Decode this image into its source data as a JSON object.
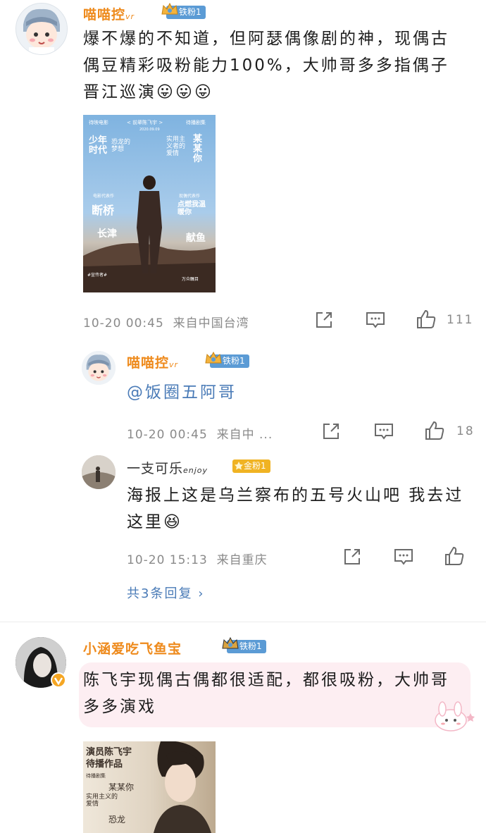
{
  "comments": [
    {
      "username": "喵喵控",
      "username_suffix": "vr",
      "badge": "铁粉1",
      "text": "爆不爆的不知道，但阿瑟偶像剧的神，现偶古偶豆精彩吸粉能力100%，大帅哥多多指偶子晋江巡演",
      "emoji": "😛😛😛",
      "timestamp": "10-20 00:45",
      "source": "来自中国台湾",
      "like_count": "111"
    },
    {
      "username": "喵喵控",
      "username_suffix": "vr",
      "badge": "铁粉1",
      "mention": "@饭圈五阿哥",
      "timestamp": "10-20 00:45",
      "source": "来自中 ...",
      "like_count": "18"
    },
    {
      "username": "一支可乐",
      "username_suffix": "enjoy",
      "badge": "金粉1",
      "text": "海报上这是乌兰察布的五号火山吧 我去过这里",
      "emoji": "😆",
      "timestamp": "10-20 15:13",
      "source": "来自重庆",
      "like_count": ""
    },
    {
      "username": "小涵爱吃飞鱼宝",
      "badge": "铁粉1",
      "text": "陈飞宇现偶古偶都很适配，都很吸粉，大帅哥多多演戏"
    }
  ],
  "replies_link": "共3条回复",
  "poster1": {
    "header_left": "待映电影",
    "header_mid": "< 前辈陈飞宇 >",
    "header_right": "待播剧集",
    "date": "2020.09.09",
    "title_left": "少年时代",
    "title_left2": "恐龙的梦想",
    "title_right": "实用主义者的爱情",
    "title_right2": "某某你",
    "film_rep_label": "电影代表作",
    "film_rep": "断桥",
    "film_rep2": "长津",
    "tv_rep_label": "现偶代表作",
    "tv_rep": "点燃我温暖你",
    "tv_rep2": "献鱼",
    "footnote_left": "#宣传者#",
    "footnote_right": "万众瞩目"
  },
  "poster2": {
    "title": "演员陈飞宇",
    "subtitle": "待播作品",
    "tag": "待播剧集",
    "work1": "某某你",
    "work2": "实用主义的爱情",
    "work3": "恐龙"
  },
  "colors": {
    "name": "#ee8a1c",
    "iron_badge": "#5b9bd5",
    "gold_badge": "#f0b323",
    "link": "#4a7bb7",
    "meta": "#8a8a8a",
    "highlight_bg": "#fdeef2"
  }
}
